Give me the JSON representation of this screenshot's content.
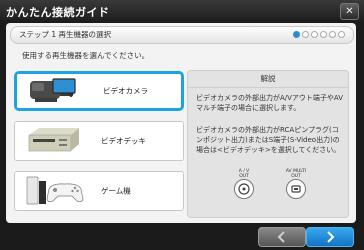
{
  "window": {
    "title": "かんたん接続ガイド",
    "close_glyph": "✕"
  },
  "step": {
    "label": "ステップ 1   再生機器の選択",
    "total": 6,
    "current": 1
  },
  "instruction": "使用する再生機器を選んでください。",
  "devices": [
    {
      "label": "ビデオカメラ",
      "icon": "video-camera-icon",
      "selected": true
    },
    {
      "label": "ビデオデッキ",
      "icon": "vcr-icon",
      "selected": false
    },
    {
      "label": "ゲーム機",
      "icon": "game-console-icon",
      "selected": false
    }
  ],
  "explanation": {
    "heading": "解説",
    "para1": "ビデオカメラの外部出力がA/Vアウト端子やAVマルチ端子の場合に選択します。",
    "para2": "ビデオカメラの外部出力がRCAピンプラグ(コンポジット出力)またはS端子(S-Video出力)の場合は<ビデオデッキ>を選択してください。",
    "ports": [
      {
        "line1": "A / V",
        "line2": "OUT",
        "icon": "av-out-port-icon"
      },
      {
        "line1": "AV MULTI",
        "line2": "OUT",
        "icon": "av-multi-out-port-icon"
      }
    ]
  },
  "nav": {
    "back_glyph": "‹",
    "next_glyph": "›"
  },
  "colors": {
    "accent": "#1ea2e0",
    "next_button": "#1a8ad8",
    "background": "#1b1b1b"
  }
}
